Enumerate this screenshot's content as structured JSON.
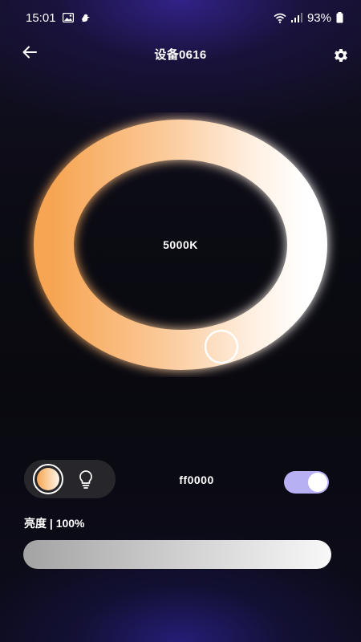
{
  "status_bar": {
    "time": "15:01",
    "battery": "93%",
    "icons_left": [
      "image-icon",
      "bird-icon"
    ],
    "icons_right": [
      "wifi-icon",
      "signal-icon",
      "battery-icon"
    ]
  },
  "header": {
    "title": "设备0616",
    "back_icon": "arrow-left-icon",
    "settings_icon": "gear-icon"
  },
  "color_ring": {
    "value_label": "5000K",
    "gradient_start": "#f7a553",
    "gradient_end": "#ffffff"
  },
  "controls": {
    "modes": [
      {
        "name": "warm-white",
        "icon": "warm-color-swatch",
        "selected": true
      },
      {
        "name": "bulb",
        "icon": "lightbulb-icon",
        "selected": false
      }
    ],
    "hex_value": "ff0000",
    "toggle_on": true,
    "toggle_color": "#b7b0f3"
  },
  "brightness": {
    "label": "亮度 | 100%",
    "percent": 100
  }
}
